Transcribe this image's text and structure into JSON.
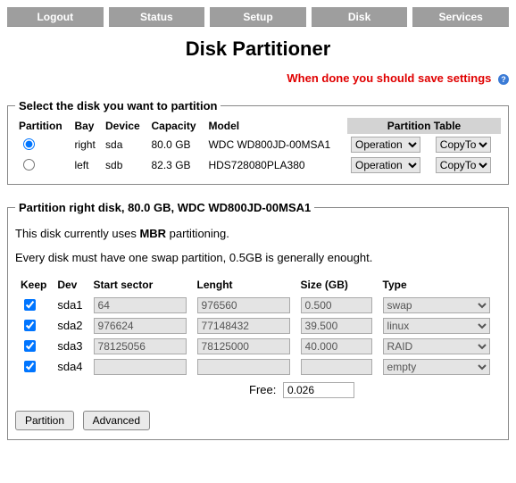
{
  "nav": {
    "logout": "Logout",
    "status": "Status",
    "setup": "Setup",
    "disk": "Disk",
    "services": "Services"
  },
  "title": "Disk Partitioner",
  "warning": "When done you should save settings",
  "select_fieldset": {
    "legend": "Select the disk you want to partition",
    "cols": {
      "partition": "Partition",
      "bay": "Bay",
      "device": "Device",
      "capacity": "Capacity",
      "model": "Model",
      "ptable": "Partition Table"
    },
    "operation_label": "Operation",
    "copyto_label": "CopyTo",
    "rows": [
      {
        "bay": "right",
        "device": "sda",
        "capacity": "80.0 GB",
        "model": "WDC WD800JD-00MSA1"
      },
      {
        "bay": "left",
        "device": "sdb",
        "capacity": "82.3 GB",
        "model": "HDS728080PLA380"
      }
    ]
  },
  "part_fieldset": {
    "legend": "Partition right disk, 80.0 GB, WDC WD800JD-00MSA1",
    "line1a": "This disk currently uses ",
    "line1b": "MBR",
    "line1c": " partitioning.",
    "line2": "Every disk must have one swap partition, 0.5GB is generally enought.",
    "cols": {
      "keep": "Keep",
      "dev": "Dev",
      "start": "Start sector",
      "length": "Lenght",
      "size": "Size (GB)",
      "type": "Type"
    },
    "rows": [
      {
        "dev": "sda1",
        "start": "64",
        "length": "976560",
        "size": "0.500",
        "type": "swap"
      },
      {
        "dev": "sda2",
        "start": "976624",
        "length": "77148432",
        "size": "39.500",
        "type": "linux"
      },
      {
        "dev": "sda3",
        "start": "78125056",
        "length": "78125000",
        "size": "40.000",
        "type": "RAID"
      },
      {
        "dev": "sda4",
        "start": "",
        "length": "",
        "size": "",
        "type": "empty"
      }
    ],
    "free_label": "Free:",
    "free_value": "0.026",
    "buttons": {
      "partition": "Partition",
      "advanced": "Advanced"
    }
  }
}
